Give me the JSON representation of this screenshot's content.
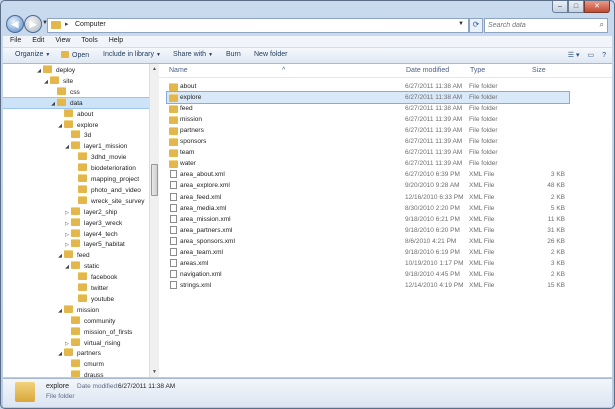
{
  "address": {
    "location": "Computer",
    "search_placeholder": "Search data"
  },
  "menu": [
    "File",
    "Edit",
    "View",
    "Tools",
    "Help"
  ],
  "toolbar": {
    "organize": "Organize",
    "open": "Open",
    "include": "Include in library",
    "share": "Share with",
    "burn": "Burn",
    "new_folder": "New folder"
  },
  "tree": [
    {
      "label": "deploy",
      "level": 4,
      "tw": "◢"
    },
    {
      "label": "site",
      "level": 5,
      "tw": "◢"
    },
    {
      "label": "css",
      "level": 6,
      "tw": ""
    },
    {
      "label": "data",
      "level": 6,
      "tw": "◢",
      "selected": true
    },
    {
      "label": "about",
      "level": 7,
      "tw": ""
    },
    {
      "label": "explore",
      "level": 7,
      "tw": "◢"
    },
    {
      "label": "3d",
      "level": 8,
      "tw": ""
    },
    {
      "label": "layer1_mission",
      "level": 8,
      "tw": "◢"
    },
    {
      "label": "3dhd_movie",
      "level": 9,
      "tw": ""
    },
    {
      "label": "biodeterioration",
      "level": 9,
      "tw": ""
    },
    {
      "label": "mapping_project",
      "level": 9,
      "tw": ""
    },
    {
      "label": "photo_and_video",
      "level": 9,
      "tw": ""
    },
    {
      "label": "wreck_site_survey",
      "level": 9,
      "tw": ""
    },
    {
      "label": "layer2_ship",
      "level": 8,
      "tw": "▷"
    },
    {
      "label": "layer3_wreck",
      "level": 8,
      "tw": "▷"
    },
    {
      "label": "layer4_tech",
      "level": 8,
      "tw": "▷"
    },
    {
      "label": "layer5_habitat",
      "level": 8,
      "tw": "▷"
    },
    {
      "label": "feed",
      "level": 7,
      "tw": "◢"
    },
    {
      "label": "static",
      "level": 8,
      "tw": "◢"
    },
    {
      "label": "facebook",
      "level": 9,
      "tw": ""
    },
    {
      "label": "twitter",
      "level": 9,
      "tw": ""
    },
    {
      "label": "youtube",
      "level": 9,
      "tw": ""
    },
    {
      "label": "mission",
      "level": 7,
      "tw": "◢"
    },
    {
      "label": "community",
      "level": 8,
      "tw": ""
    },
    {
      "label": "mission_of_firsts",
      "level": 8,
      "tw": ""
    },
    {
      "label": "virtual_rising",
      "level": 8,
      "tw": "▷"
    },
    {
      "label": "partners",
      "level": 7,
      "tw": "◢"
    },
    {
      "label": "cmurm",
      "level": 8,
      "tw": ""
    },
    {
      "label": "drauss",
      "level": 8,
      "tw": ""
    }
  ],
  "columns": {
    "name": "Name",
    "date": "Date modified",
    "type": "Type",
    "size": "Size"
  },
  "files": [
    {
      "name": "about",
      "date": "6/27/2011 11:38 AM",
      "type": "File folder",
      "size": "",
      "kind": "folder"
    },
    {
      "name": "explore",
      "date": "6/27/2011 11:38 AM",
      "type": "File folder",
      "size": "",
      "kind": "folder",
      "selected": true
    },
    {
      "name": "feed",
      "date": "6/27/2011 11:38 AM",
      "type": "File folder",
      "size": "",
      "kind": "folder"
    },
    {
      "name": "mission",
      "date": "6/27/2011 11:39 AM",
      "type": "File folder",
      "size": "",
      "kind": "folder"
    },
    {
      "name": "partners",
      "date": "6/27/2011 11:39 AM",
      "type": "File folder",
      "size": "",
      "kind": "folder"
    },
    {
      "name": "sponsors",
      "date": "6/27/2011 11:39 AM",
      "type": "File folder",
      "size": "",
      "kind": "folder"
    },
    {
      "name": "team",
      "date": "6/27/2011 11:39 AM",
      "type": "File folder",
      "size": "",
      "kind": "folder"
    },
    {
      "name": "water",
      "date": "6/27/2011 11:39 AM",
      "type": "File folder",
      "size": "",
      "kind": "folder"
    },
    {
      "name": "area_about.xml",
      "date": "6/27/2010 6:39 PM",
      "type": "XML File",
      "size": "3 KB",
      "kind": "xml"
    },
    {
      "name": "area_explore.xml",
      "date": "9/20/2010 9:28 AM",
      "type": "XML File",
      "size": "48 KB",
      "kind": "xml"
    },
    {
      "name": "area_feed.xml",
      "date": "12/16/2010 6:33 PM",
      "type": "XML File",
      "size": "2 KB",
      "kind": "xml"
    },
    {
      "name": "area_media.xml",
      "date": "8/30/2010 2:20 PM",
      "type": "XML File",
      "size": "5 KB",
      "kind": "xml"
    },
    {
      "name": "area_mission.xml",
      "date": "9/18/2010 6:21 PM",
      "type": "XML File",
      "size": "11 KB",
      "kind": "xml"
    },
    {
      "name": "area_partners.xml",
      "date": "9/18/2010 6:20 PM",
      "type": "XML File",
      "size": "31 KB",
      "kind": "xml"
    },
    {
      "name": "area_sponsors.xml",
      "date": "8/6/2010 4:21 PM",
      "type": "XML File",
      "size": "26 KB",
      "kind": "xml"
    },
    {
      "name": "area_team.xml",
      "date": "9/18/2010 6:19 PM",
      "type": "XML File",
      "size": "2 KB",
      "kind": "xml"
    },
    {
      "name": "areas.xml",
      "date": "10/19/2010 1:17 PM",
      "type": "XML File",
      "size": "3 KB",
      "kind": "xml"
    },
    {
      "name": "navigation.xml",
      "date": "9/18/2010 4:45 PM",
      "type": "XML File",
      "size": "2 KB",
      "kind": "xml"
    },
    {
      "name": "strings.xml",
      "date": "12/14/2010 4:19 PM",
      "type": "XML File",
      "size": "15 KB",
      "kind": "xml"
    }
  ],
  "details": {
    "name": "explore",
    "modified_label": "Date modified:",
    "modified": "6/27/2011 11:38 AM",
    "type": "File folder"
  }
}
